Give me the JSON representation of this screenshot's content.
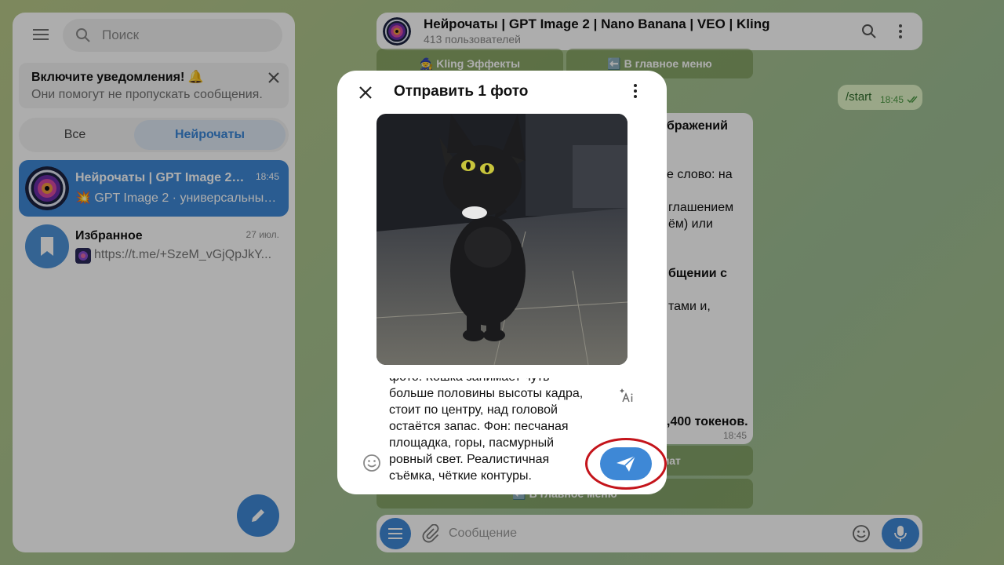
{
  "sidebar": {
    "search_placeholder": "Поиск",
    "notification": {
      "title": "Включите уведомления! 🔔",
      "subtitle": "Они помогут не пропускать сообщения."
    },
    "tabs": [
      {
        "label": "Все",
        "active": false
      },
      {
        "label": "Нейрочаты",
        "active": true
      }
    ],
    "chats": [
      {
        "name": "Нейрочаты | GPT Image 2 | ...",
        "time": "18:45",
        "preview": "💥 GPT Image 2 · универсальный ...",
        "active": true
      },
      {
        "name": "Избранное",
        "time": "27 июл.",
        "preview": "https://t.me/+SzeM_vGjQpJkY...",
        "active": false
      }
    ]
  },
  "header": {
    "title": "Нейрочаты | GPT Image 2 | Nano Banana | VEO | Kling",
    "subtitle": "413 пользователей"
  },
  "keyboard": {
    "top_buttons": [
      "🧙 Kling Эффекты",
      "⬅️ В главное меню"
    ],
    "bottom_buttons": [
      "формат",
      "⬅️ В главное меню"
    ]
  },
  "outgoing": {
    "text": "/start",
    "time": "18:45"
  },
  "bot_message": {
    "fragments": [
      "бражений",
      "е слово: на",
      "глашением",
      "ём) или",
      "бщении с",
      "тами и,",
      ",400 токенов."
    ],
    "time": "18:45"
  },
  "composer": {
    "placeholder": "Сообщение"
  },
  "modal": {
    "title": "Отправить 1 фото",
    "caption_lines": [
      "фото. Кошка занимает чуть",
      "больше половины высоты кадра,",
      "стоит по центру, над головой",
      "остаётся запас. Фон: песчаная",
      "площадка, горы, пасмурный",
      "ровный свет. Реалистичная",
      "съёмка, чёткие контуры."
    ]
  },
  "colors": {
    "accent": "#3e88d6",
    "highlight": "#c4141b",
    "outgoing_bubble": "#e3f7c9"
  }
}
